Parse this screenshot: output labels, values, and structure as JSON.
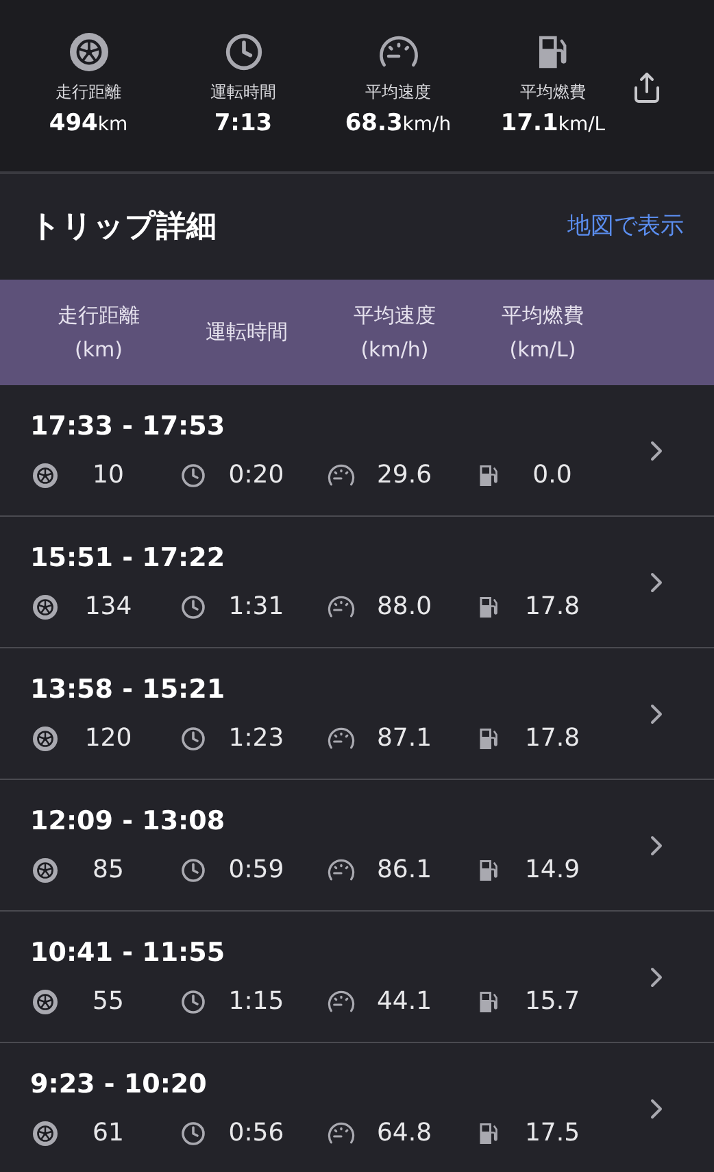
{
  "summary": [
    {
      "kind": "distance",
      "label": "走行距離",
      "value": "494",
      "unit": "km"
    },
    {
      "kind": "time",
      "label": "運転時間",
      "value": "7:13"
    },
    {
      "kind": "speed",
      "label": "平均速度",
      "value": "68.3",
      "unit": "km/h"
    },
    {
      "kind": "fuel",
      "label": "平均燃費",
      "value": "17.1",
      "unit": "km/L"
    }
  ],
  "section": {
    "title": "トリップ詳細",
    "link": "地図で表示"
  },
  "columns": [
    [
      "走行距離",
      "(km)"
    ],
    [
      "運転時間"
    ],
    [
      "平均速度",
      "(km/h)"
    ],
    [
      "平均燃費",
      "(km/L)"
    ]
  ],
  "trips": [
    {
      "time": "17:33 - 17:53",
      "distance": "10",
      "duration": "0:20",
      "speed": "29.6",
      "fuel": "0.0"
    },
    {
      "time": "15:51 - 17:22",
      "distance": "134",
      "duration": "1:31",
      "speed": "88.0",
      "fuel": "17.8"
    },
    {
      "time": "13:58 - 15:21",
      "distance": "120",
      "duration": "1:23",
      "speed": "87.1",
      "fuel": "17.8"
    },
    {
      "time": "12:09 - 13:08",
      "distance": "85",
      "duration": "0:59",
      "speed": "86.1",
      "fuel": "14.9"
    },
    {
      "time": "10:41 - 11:55",
      "distance": "55",
      "duration": "1:15",
      "speed": "44.1",
      "fuel": "15.7"
    },
    {
      "time": "9:23 - 10:20",
      "distance": "61",
      "duration": "0:56",
      "speed": "64.8",
      "fuel": "17.5"
    }
  ]
}
